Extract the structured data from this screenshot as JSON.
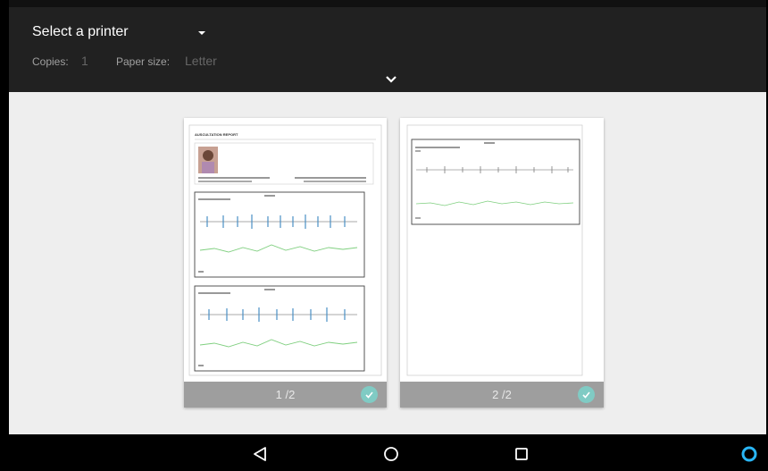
{
  "header": {
    "printer_label": "Select a printer",
    "copies_label": "Copies:",
    "copies_value": "1",
    "paper_size_label": "Paper size:",
    "paper_size_value": "Letter"
  },
  "pages": [
    {
      "label": "1 /2",
      "selected": true
    },
    {
      "label": "2 /2",
      "selected": true
    }
  ],
  "navbar": {
    "icons": [
      "back-icon",
      "home-icon",
      "recents-icon",
      "assistant-icon"
    ]
  },
  "colors": {
    "header_bg": "#212121",
    "preview_bg": "#eeeeee",
    "page_footer": "#9e9e9e",
    "check_accent": "#80cbc4"
  }
}
